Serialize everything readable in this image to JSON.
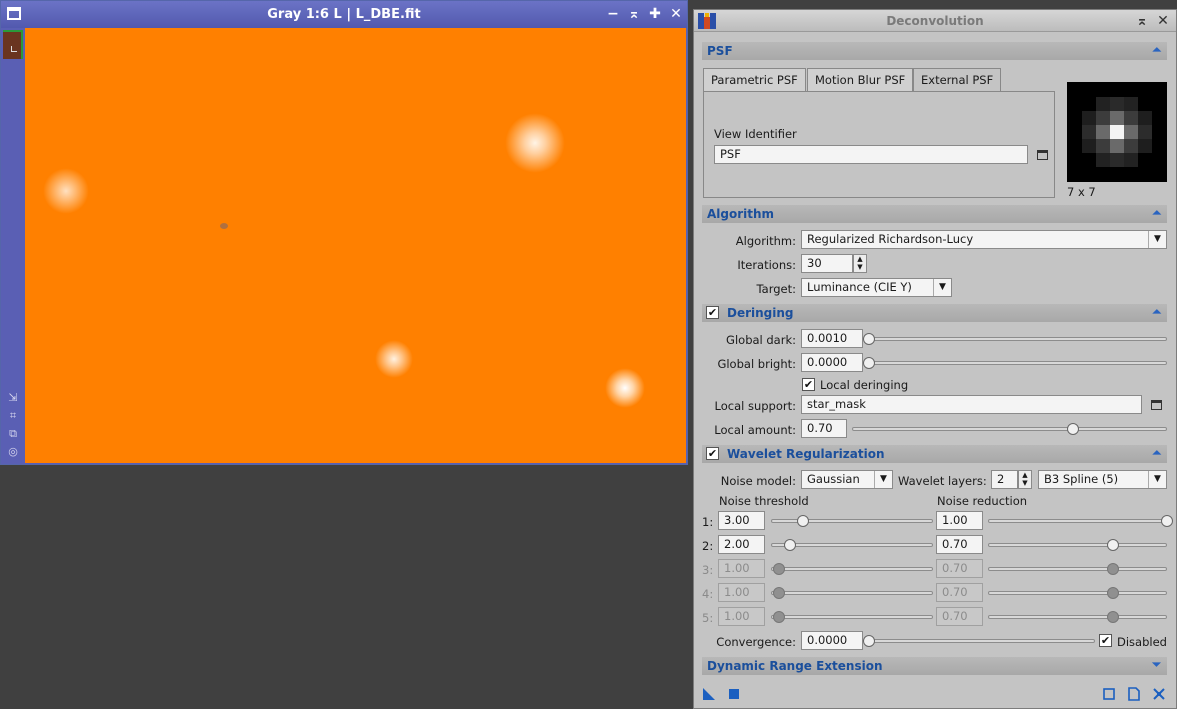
{
  "image_window": {
    "title": "Gray 1:6 L | L_DBE.fit",
    "buttons": {
      "minimize": "−",
      "shade": "⌅",
      "maximize": "✚",
      "close": "✕"
    },
    "background_color": "#ff8000"
  },
  "dialog": {
    "title": "Deconvolution",
    "buttons": {
      "shade": "⌅",
      "close": "✕"
    },
    "psf": {
      "header": "PSF",
      "tabs": [
        "Parametric PSF",
        "Motion Blur PSF",
        "External PSF"
      ],
      "active_tab": "External PSF",
      "view_identifier_label": "View Identifier",
      "view_identifier_value": "PSF",
      "preview_size": "7 x 7"
    },
    "algorithm": {
      "header": "Algorithm",
      "algorithm_label": "Algorithm:",
      "algorithm_value": "Regularized Richardson-Lucy",
      "iterations_label": "Iterations:",
      "iterations_value": "30",
      "target_label": "Target:",
      "target_value": "Luminance (CIE Y)"
    },
    "deringing": {
      "header": "Deringing",
      "enabled": true,
      "global_dark_label": "Global dark:",
      "global_dark_value": "0.0010",
      "global_dark_pos": 0.0,
      "global_bright_label": "Global bright:",
      "global_bright_value": "0.0000",
      "global_bright_pos": 0.0,
      "local_deringing_label": "Local deringing",
      "local_deringing_checked": true,
      "local_support_label": "Local support:",
      "local_support_value": "star_mask",
      "local_amount_label": "Local amount:",
      "local_amount_value": "0.70",
      "local_amount_pos": 0.7
    },
    "wavelet": {
      "header": "Wavelet Regularization",
      "enabled": true,
      "noise_model_label": "Noise model:",
      "noise_model_value": "Gaussian",
      "wavelet_layers_label": "Wavelet layers:",
      "wavelet_layers_value": "2",
      "scaling_function_value": "B3 Spline (5)",
      "noise_threshold_header": "Noise threshold",
      "noise_reduction_header": "Noise reduction",
      "rows": [
        {
          "index": "1:",
          "threshold": "3.00",
          "reduction": "1.00",
          "enabled": true
        },
        {
          "index": "2:",
          "threshold": "2.00",
          "reduction": "0.70",
          "enabled": true
        },
        {
          "index": "3:",
          "threshold": "1.00",
          "reduction": "0.70",
          "enabled": false
        },
        {
          "index": "4:",
          "threshold": "1.00",
          "reduction": "0.70",
          "enabled": false
        },
        {
          "index": "5:",
          "threshold": "1.00",
          "reduction": "0.70",
          "enabled": false
        }
      ],
      "convergence_label": "Convergence:",
      "convergence_value": "0.0000",
      "disabled_label": "Disabled",
      "disabled_checked": true
    },
    "dynamic_range": {
      "header": "Dynamic Range Extension"
    },
    "colors": {
      "accent": "#1b4f9c",
      "section_bg": "#b0b0b0",
      "panel_bg": "#c4c4c4"
    }
  }
}
